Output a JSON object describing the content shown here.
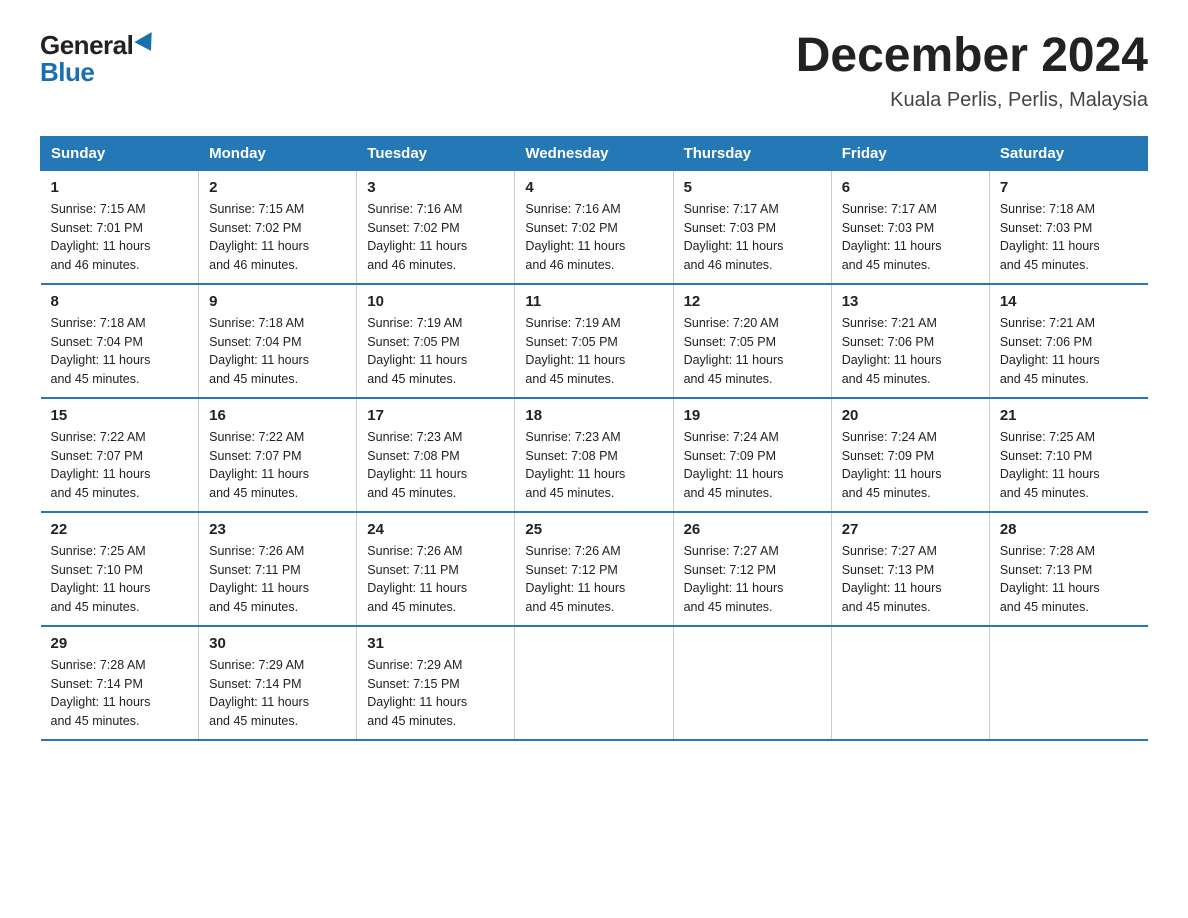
{
  "header": {
    "logo_general": "General",
    "logo_blue": "Blue",
    "month_title": "December 2024",
    "location": "Kuala Perlis, Perlis, Malaysia"
  },
  "days_of_week": [
    "Sunday",
    "Monday",
    "Tuesday",
    "Wednesday",
    "Thursday",
    "Friday",
    "Saturday"
  ],
  "weeks": [
    [
      {
        "day": "1",
        "sunrise": "7:15 AM",
        "sunset": "7:01 PM",
        "daylight": "11 hours and 46 minutes."
      },
      {
        "day": "2",
        "sunrise": "7:15 AM",
        "sunset": "7:02 PM",
        "daylight": "11 hours and 46 minutes."
      },
      {
        "day": "3",
        "sunrise": "7:16 AM",
        "sunset": "7:02 PM",
        "daylight": "11 hours and 46 minutes."
      },
      {
        "day": "4",
        "sunrise": "7:16 AM",
        "sunset": "7:02 PM",
        "daylight": "11 hours and 46 minutes."
      },
      {
        "day": "5",
        "sunrise": "7:17 AM",
        "sunset": "7:03 PM",
        "daylight": "11 hours and 46 minutes."
      },
      {
        "day": "6",
        "sunrise": "7:17 AM",
        "sunset": "7:03 PM",
        "daylight": "11 hours and 45 minutes."
      },
      {
        "day": "7",
        "sunrise": "7:18 AM",
        "sunset": "7:03 PM",
        "daylight": "11 hours and 45 minutes."
      }
    ],
    [
      {
        "day": "8",
        "sunrise": "7:18 AM",
        "sunset": "7:04 PM",
        "daylight": "11 hours and 45 minutes."
      },
      {
        "day": "9",
        "sunrise": "7:18 AM",
        "sunset": "7:04 PM",
        "daylight": "11 hours and 45 minutes."
      },
      {
        "day": "10",
        "sunrise": "7:19 AM",
        "sunset": "7:05 PM",
        "daylight": "11 hours and 45 minutes."
      },
      {
        "day": "11",
        "sunrise": "7:19 AM",
        "sunset": "7:05 PM",
        "daylight": "11 hours and 45 minutes."
      },
      {
        "day": "12",
        "sunrise": "7:20 AM",
        "sunset": "7:05 PM",
        "daylight": "11 hours and 45 minutes."
      },
      {
        "day": "13",
        "sunrise": "7:21 AM",
        "sunset": "7:06 PM",
        "daylight": "11 hours and 45 minutes."
      },
      {
        "day": "14",
        "sunrise": "7:21 AM",
        "sunset": "7:06 PM",
        "daylight": "11 hours and 45 minutes."
      }
    ],
    [
      {
        "day": "15",
        "sunrise": "7:22 AM",
        "sunset": "7:07 PM",
        "daylight": "11 hours and 45 minutes."
      },
      {
        "day": "16",
        "sunrise": "7:22 AM",
        "sunset": "7:07 PM",
        "daylight": "11 hours and 45 minutes."
      },
      {
        "day": "17",
        "sunrise": "7:23 AM",
        "sunset": "7:08 PM",
        "daylight": "11 hours and 45 minutes."
      },
      {
        "day": "18",
        "sunrise": "7:23 AM",
        "sunset": "7:08 PM",
        "daylight": "11 hours and 45 minutes."
      },
      {
        "day": "19",
        "sunrise": "7:24 AM",
        "sunset": "7:09 PM",
        "daylight": "11 hours and 45 minutes."
      },
      {
        "day": "20",
        "sunrise": "7:24 AM",
        "sunset": "7:09 PM",
        "daylight": "11 hours and 45 minutes."
      },
      {
        "day": "21",
        "sunrise": "7:25 AM",
        "sunset": "7:10 PM",
        "daylight": "11 hours and 45 minutes."
      }
    ],
    [
      {
        "day": "22",
        "sunrise": "7:25 AM",
        "sunset": "7:10 PM",
        "daylight": "11 hours and 45 minutes."
      },
      {
        "day": "23",
        "sunrise": "7:26 AM",
        "sunset": "7:11 PM",
        "daylight": "11 hours and 45 minutes."
      },
      {
        "day": "24",
        "sunrise": "7:26 AM",
        "sunset": "7:11 PM",
        "daylight": "11 hours and 45 minutes."
      },
      {
        "day": "25",
        "sunrise": "7:26 AM",
        "sunset": "7:12 PM",
        "daylight": "11 hours and 45 minutes."
      },
      {
        "day": "26",
        "sunrise": "7:27 AM",
        "sunset": "7:12 PM",
        "daylight": "11 hours and 45 minutes."
      },
      {
        "day": "27",
        "sunrise": "7:27 AM",
        "sunset": "7:13 PM",
        "daylight": "11 hours and 45 minutes."
      },
      {
        "day": "28",
        "sunrise": "7:28 AM",
        "sunset": "7:13 PM",
        "daylight": "11 hours and 45 minutes."
      }
    ],
    [
      {
        "day": "29",
        "sunrise": "7:28 AM",
        "sunset": "7:14 PM",
        "daylight": "11 hours and 45 minutes."
      },
      {
        "day": "30",
        "sunrise": "7:29 AM",
        "sunset": "7:14 PM",
        "daylight": "11 hours and 45 minutes."
      },
      {
        "day": "31",
        "sunrise": "7:29 AM",
        "sunset": "7:15 PM",
        "daylight": "11 hours and 45 minutes."
      },
      null,
      null,
      null,
      null
    ]
  ],
  "sunrise_label": "Sunrise:",
  "sunset_label": "Sunset:",
  "daylight_label": "Daylight:"
}
